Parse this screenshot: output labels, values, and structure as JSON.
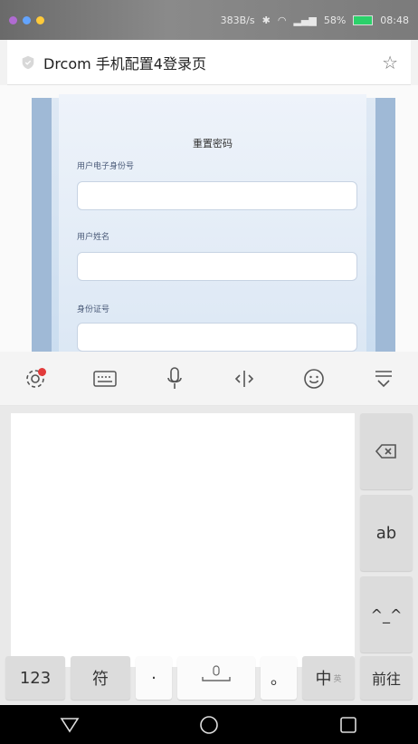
{
  "status_bar": {
    "speed": "383B/s",
    "battery": "58%",
    "time": "08:48"
  },
  "browser": {
    "page_title": "Drcom 手机配置4登录页"
  },
  "form": {
    "title": "重置密码",
    "fields": [
      {
        "label": "用户电子身份号"
      },
      {
        "label": "用户姓名"
      },
      {
        "label": "身份证号"
      }
    ]
  },
  "keyboard": {
    "keys": {
      "num": "123",
      "symbols": "符",
      "comma": "·",
      "period": "。",
      "lang": "中",
      "lang_sub": "英",
      "enter": "前往",
      "ab": "ab",
      "emoticon": "^_^"
    }
  },
  "colors": {
    "accent_badge": "#e23b3b",
    "form_bg": "#dbe7f4"
  }
}
